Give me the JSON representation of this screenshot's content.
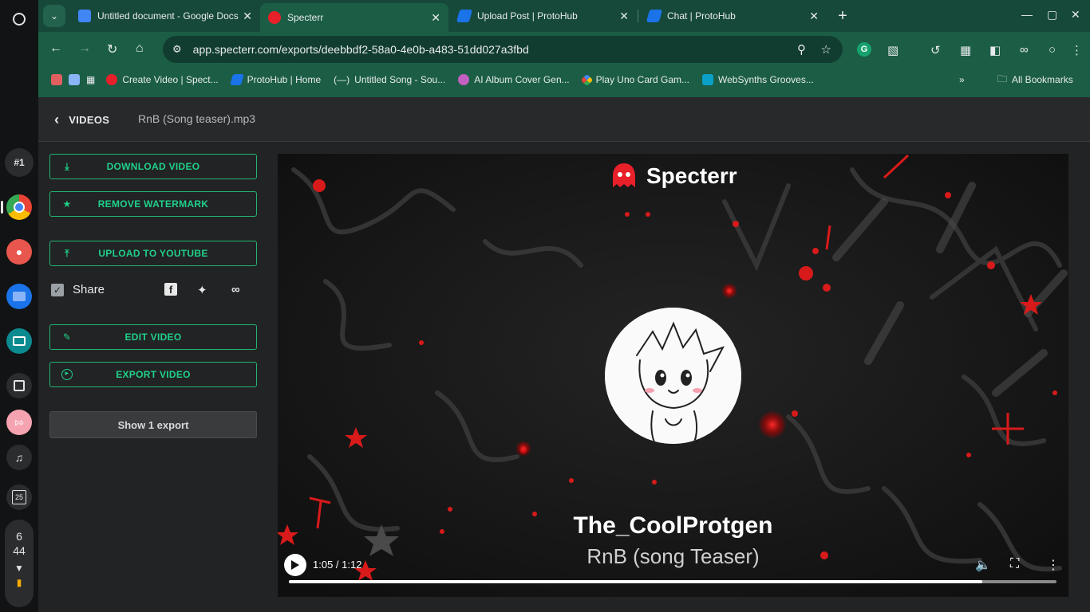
{
  "shelf": {
    "desk_label": "#1",
    "time_hour": "6",
    "time_min": "44",
    "calendar_day": "25"
  },
  "tabs": [
    {
      "title": "Untitled document - Google Docs"
    },
    {
      "title": "Specterr"
    },
    {
      "title": "Upload Post | ProtoHub"
    },
    {
      "title": "Chat | ProtoHub"
    }
  ],
  "address_bar": {
    "url": "app.specterr.com/exports/deebbdf2-58a0-4e0b-a483-51dd027a3fbd"
  },
  "bookmarks": [
    {
      "label": "Create Video | Spect..."
    },
    {
      "label": "ProtoHub | Home"
    },
    {
      "label": "Untitled Song - Sou..."
    },
    {
      "label": "AI Album Cover Gen..."
    },
    {
      "label": "Play Uno Card Gam..."
    },
    {
      "label": "WebSynths Grooves..."
    }
  ],
  "all_bookmarks_label": "All Bookmarks",
  "header": {
    "back_label": "VIDEOS",
    "file_title": "RnB (Song teaser).mp3"
  },
  "sidebar": {
    "download_label": "DOWNLOAD VIDEO",
    "remove_watermark_label": "REMOVE WATERMARK",
    "upload_youtube_label": "UPLOAD TO YOUTUBE",
    "share_label": "Share",
    "edit_label": "EDIT VIDEO",
    "export_label": "EXPORT VIDEO",
    "show_export_label": "Show 1 export"
  },
  "video": {
    "brand_name": "Specterr",
    "artist": "The_CoolProtgen",
    "song": "RnB (song Teaser)",
    "time_display": "1:05 / 1:12",
    "progress": 0.903
  },
  "colors": {
    "accent": "#1fd18a",
    "browser_frame": "#1b5e45",
    "brand_red": "#e8202a"
  }
}
